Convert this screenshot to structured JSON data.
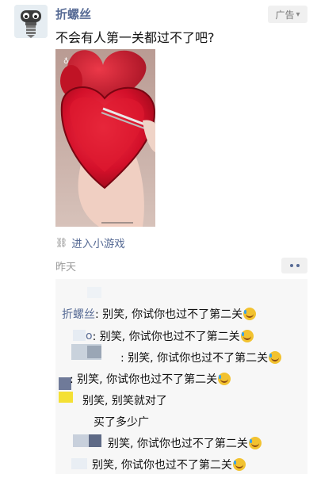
{
  "header": {
    "account_name": "折螺丝",
    "ad_label": "广告",
    "ad_chevron": "chevron-down-icon"
  },
  "post": {
    "text": "不会有人第一关都过不了吧?",
    "media_description_icon": "heart-candy-game-video",
    "mini_game_link": "进入小游戏",
    "mini_game_icon": "link-icon",
    "time": "昨天"
  },
  "comments": [
    {
      "name": "折螺丝",
      "text": ": 别笑, 你试你也过不了第二关",
      "emoji": "laugh-cry-emoji"
    },
    {
      "name": "o",
      "text": ": 别笑, 你试你也过不了第二关",
      "emoji": "laugh-cry-emoji"
    },
    {
      "name": "",
      "text": ": 别笑, 你试你也过不了第二关",
      "emoji": "laugh-cry-emoji"
    },
    {
      "name": "",
      "text": ": 别笑, 你试你也过不了第二关",
      "emoji": "laugh-cry-emoji"
    },
    {
      "name": "",
      "text": "别笑, 别笑就对了",
      "emoji": ""
    },
    {
      "name": "",
      "text": "买了多少广",
      "emoji": ""
    },
    {
      "name": "",
      "text": "别笑, 你试你也过不了第二关",
      "emoji": "laugh-cry-emoji"
    },
    {
      "name": "",
      "text": "别笑, 你试你也过不了第二关",
      "emoji": "laugh-cry-emoji"
    }
  ],
  "colors": {
    "link_blue": "#576b95",
    "comment_bg": "#f7f7f7",
    "heart_red": "#d9122a"
  }
}
